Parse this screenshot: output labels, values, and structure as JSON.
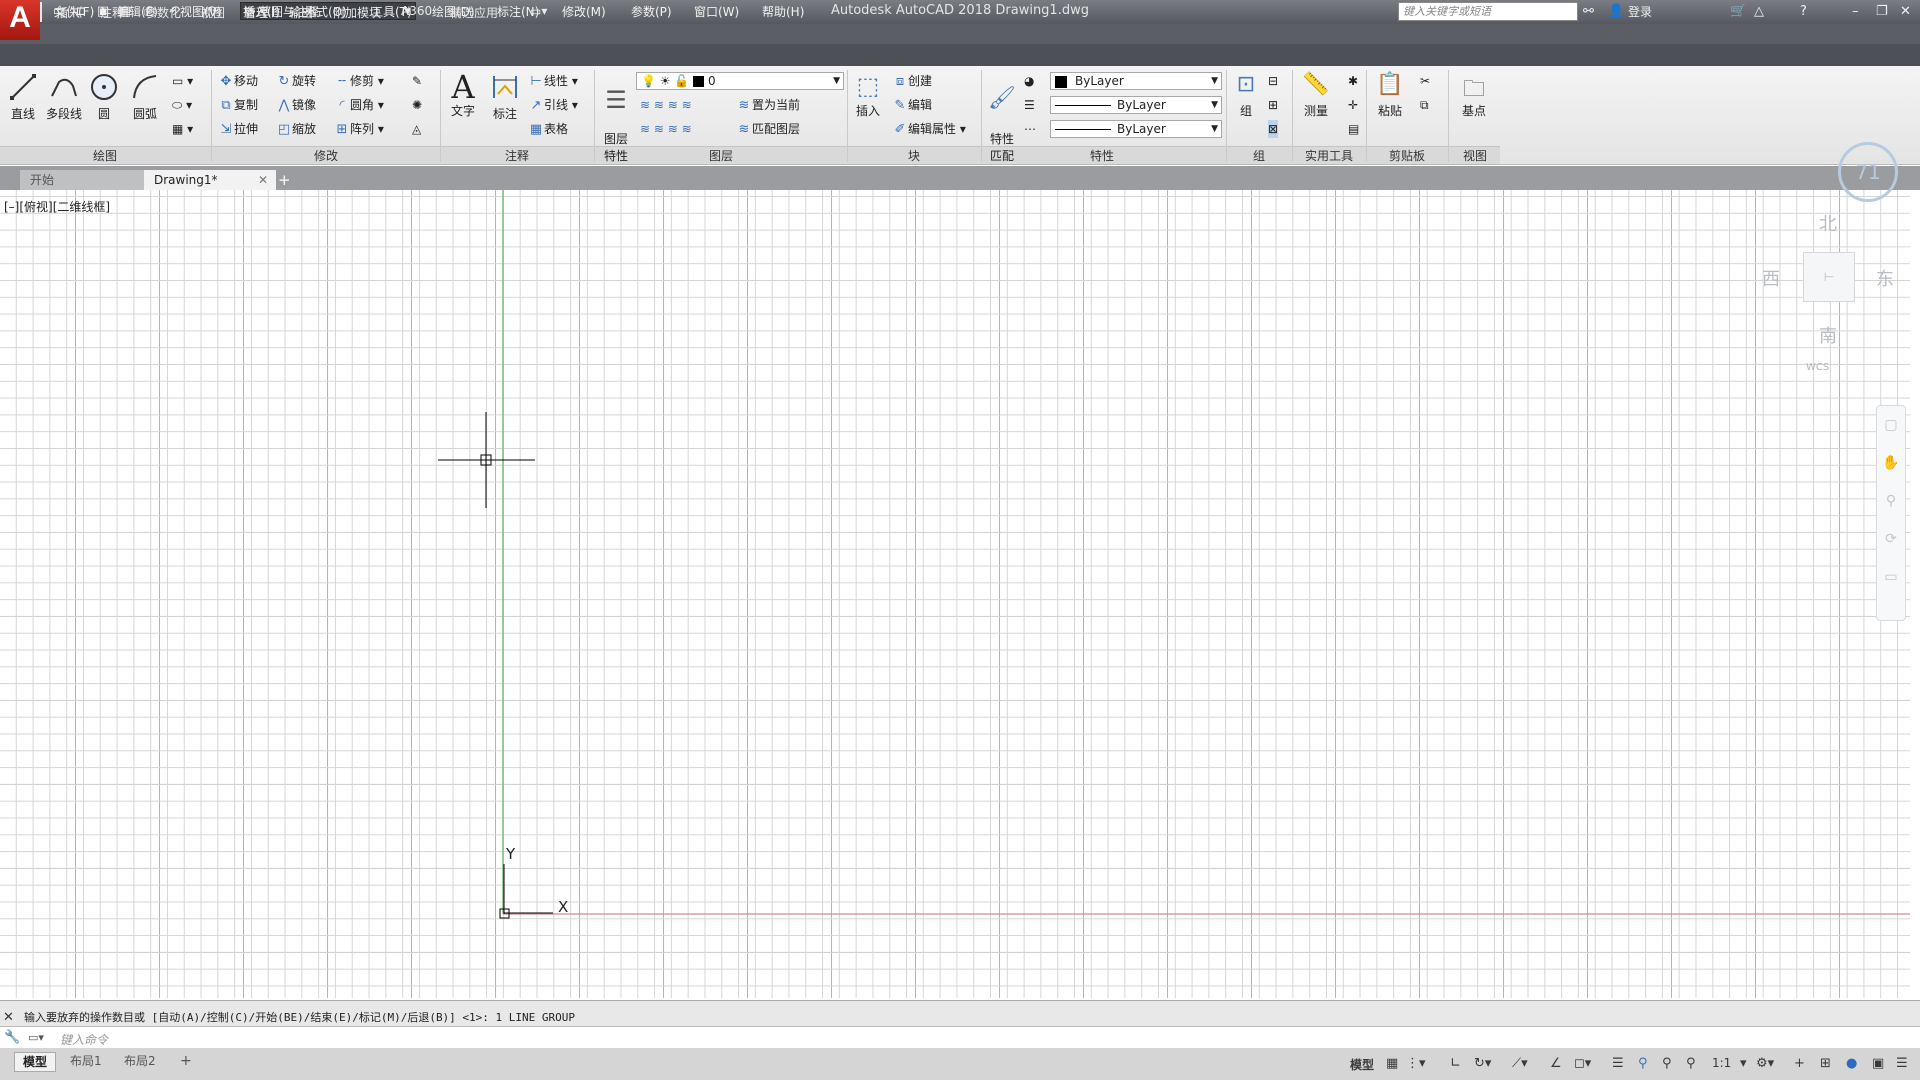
{
  "window": {
    "app_logo": "A",
    "title": "Autodesk AutoCAD 2018    Drawing1.dwg",
    "workspace": "草图与注释",
    "search_placeholder": "键入关键字或短语",
    "login": "登录"
  },
  "menus": [
    "文件(F)",
    "编辑(E)",
    "视图(V)",
    "插入(I)",
    "格式(O)",
    "工具(T)",
    "绘图(D)",
    "标注(N)",
    "修改(M)",
    "参数(P)",
    "窗口(W)",
    "帮助(H)"
  ],
  "ribbon_tabs": [
    "默认",
    "插入",
    "注释",
    "参数化",
    "视图",
    "管理",
    "输出",
    "附加模块",
    "A360",
    "精选应用"
  ],
  "panels": {
    "draw": {
      "label": "绘图",
      "line": "直线",
      "polyline": "多段线",
      "circle": "圆",
      "arc": "圆弧"
    },
    "modify": {
      "label": "修改",
      "move": "移动",
      "rotate": "旋转",
      "trim": "修剪",
      "copy": "复制",
      "mirror": "镜像",
      "fillet": "圆角",
      "stretch": "拉伸",
      "scale": "缩放",
      "array": "阵列"
    },
    "annotation": {
      "label": "注释",
      "text": "文字",
      "dimension": "标注",
      "linear": "线性",
      "leader": "引线",
      "table": "表格"
    },
    "layers": {
      "label": "图层",
      "layer_props": "图层\n特性",
      "current_layer": "0",
      "set_current": "置为当前",
      "match_layer": "匹配图层"
    },
    "block": {
      "label": "块",
      "insert": "插入",
      "create": "创建",
      "edit": "编辑",
      "edit_attr": "编辑属性"
    },
    "properties": {
      "label": "特性",
      "match": "特性\n匹配",
      "color": "ByLayer",
      "linetype": "ByLayer",
      "lineweight": "ByLayer"
    },
    "groups": {
      "label": "组",
      "group": "组"
    },
    "utilities": {
      "label": "实用工具",
      "measure": "测量"
    },
    "clipboard": {
      "label": "剪贴板",
      "paste": "粘贴"
    },
    "view": {
      "label": "视图",
      "base": "基点"
    }
  },
  "doc_tabs": [
    "开始",
    "Drawing1*"
  ],
  "viewport": {
    "label": "[–][俯视][二维线框]",
    "viewcube": {
      "north": "北",
      "south": "南",
      "east": "东",
      "west": "西",
      "wcs": "WCS"
    },
    "steering_value": "71"
  },
  "ucs": {
    "x": "X",
    "y": "Y"
  },
  "command": {
    "history": "输入要放弃的操作数目或 [自动(A)/控制(C)/开始(BE)/结束(E)/标记(M)/后退(B)] <1>: 1 LINE GROUP",
    "placeholder": "键入命令"
  },
  "layout_tabs": [
    "模型",
    "布局1",
    "布局2"
  ],
  "status": {
    "model": "模型",
    "scale": "1:1"
  },
  "colors": {
    "x_axis": "#c96b6b",
    "y_axis": "#5fae5f"
  }
}
